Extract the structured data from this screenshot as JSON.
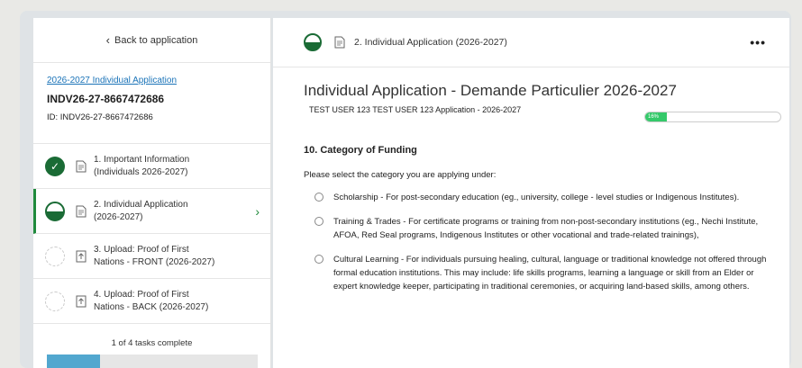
{
  "sidebar": {
    "back_label": "Back to application",
    "app_link": "2026-2027 Individual Application",
    "app_code": "INDV26-27-8667472686",
    "app_id": "ID: INDV26-27-8667472686",
    "tasks": [
      {
        "line1": "1. Important Information",
        "line2": "(Individuals 2026-2027)",
        "status": "complete"
      },
      {
        "line1": "2. Individual Application",
        "line2": "(2026-2027)",
        "status": "in-progress"
      },
      {
        "line1": "3. Upload: Proof of First",
        "line2": "Nations - FRONT (2026-2027)",
        "status": "not-started"
      },
      {
        "line1": "4. Upload: Proof of First",
        "line2": "Nations - BACK (2026-2027)",
        "status": "not-started"
      }
    ],
    "tasks_complete": "1 of 4 tasks complete",
    "progress_fraction": 0.25
  },
  "main": {
    "header_title": "2. Individual Application (2026-2027)",
    "more_label": "•••",
    "page_title": "Individual Application - Demande Particulier 2026-2027",
    "user_line": "TEST USER 123 TEST USER 123   Application - 2026-2027",
    "percent_label": "16%",
    "percent_value": 16,
    "section_title": "10. Category of Funding",
    "prompt": "Please select the category you are applying under:",
    "options": [
      "Scholarship - For post-secondary education (eg., university, college - level studies or Indigenous Institutes).",
      "Training & Trades - For certificate programs or training from non-post-secondary institutions (eg., Nechi Institute, AFOA, Red Seal programs, Indigenous Institutes or other vocational and trade-related trainings),",
      "Cultural Learning - For individuals pursuing healing, cultural, language or traditional knowledge not offered through formal education institutions. This may include: life skills programs, learning a language or skill from an Elder or expert knowledge keeper, participating in traditional ceremonies, or acquiring land-based skills, among others."
    ]
  },
  "colors": {
    "accent_green": "#1a6b35",
    "progress_blue": "#52a7cf",
    "percent_green": "#35c96a"
  }
}
